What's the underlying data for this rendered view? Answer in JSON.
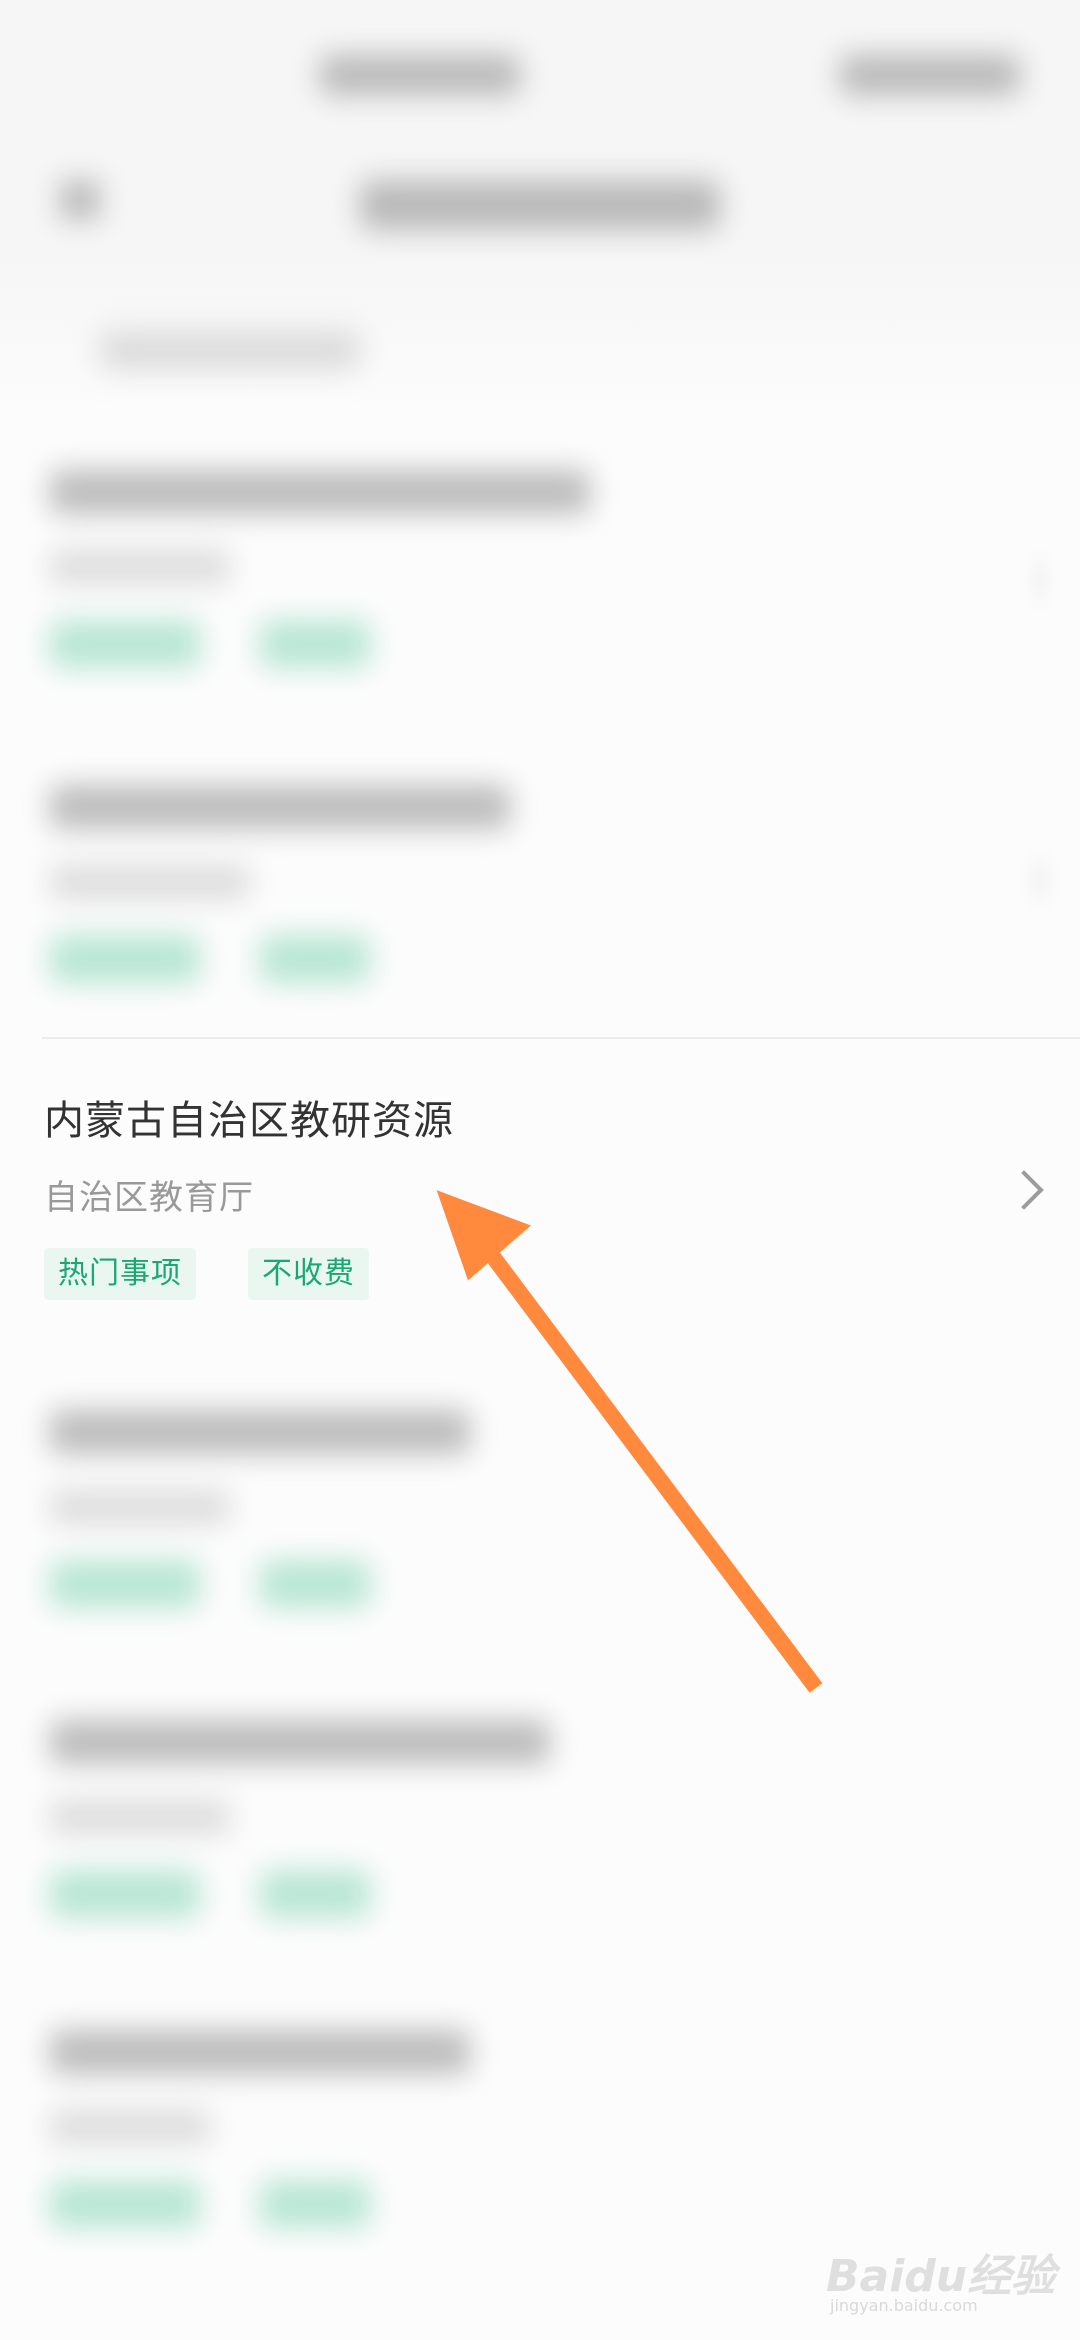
{
  "item": {
    "title": "内蒙古自治区教研资源",
    "department": "自治区教育厅",
    "tags": [
      "热门事项",
      "不收费"
    ]
  },
  "icons": {
    "chevron": "chevron-right-icon",
    "annotation": "orange-arrow"
  },
  "colors": {
    "tag_text": "#1aa872",
    "tag_bg": "#eaf7f1",
    "arrow": "#ff8a3d"
  },
  "watermark": {
    "brand": "Baidu经验",
    "site": "jingyan.baidu.com"
  }
}
